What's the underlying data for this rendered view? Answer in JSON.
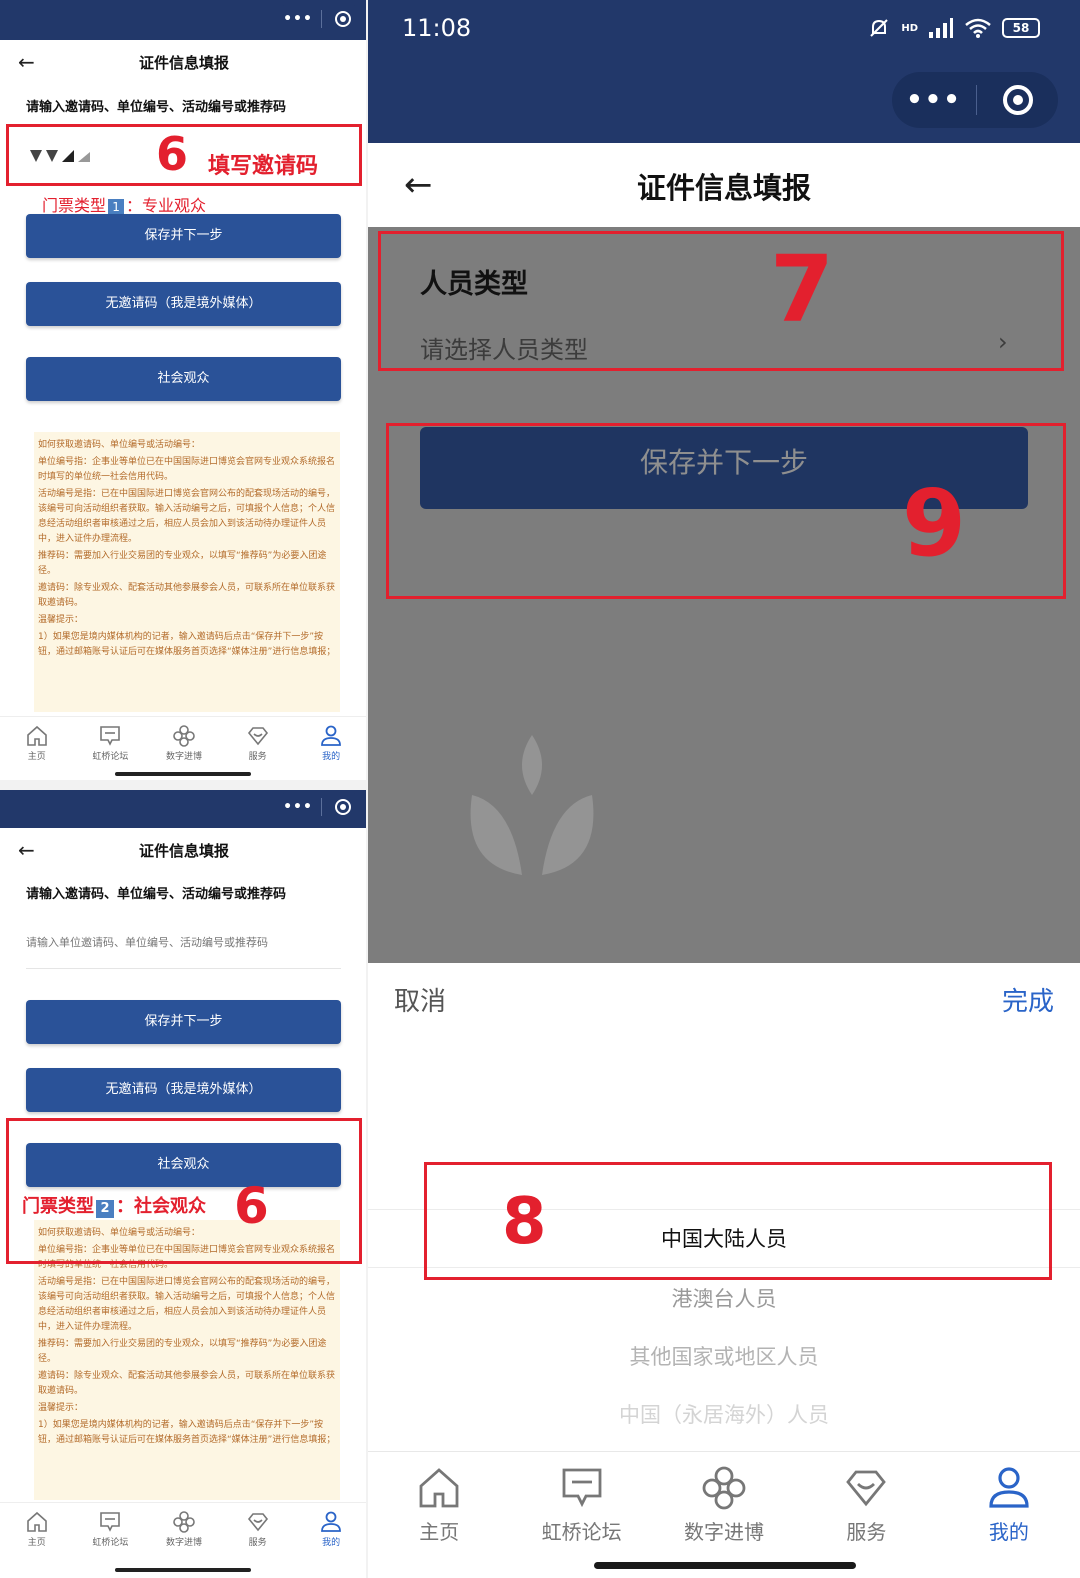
{
  "colors": {
    "brand_blue": "#22386a",
    "button_blue": "#2a5298",
    "annotation_red": "#e3202e",
    "tip_text": "#b36b2a",
    "tip_bg": "#fdf6e3",
    "done_blue": "#2a64c8"
  },
  "icons": [
    "more-dots-icon",
    "target-icon",
    "back-arrow-icon",
    "home-icon",
    "forum-icon",
    "digital-icon",
    "service-icon",
    "user-icon",
    "chevron-right-icon",
    "mute-bell-icon",
    "signal-icon",
    "wifi-icon",
    "battery-icon"
  ],
  "screen1": {
    "title": "证件信息填报",
    "prompt": "请输入邀请码、单位编号、活动编号或推荐码",
    "annotation_number": "6",
    "annotation_text": "填写邀请码",
    "ticket_note": "门票类型",
    "ticket_badge": "1",
    "ticket_value": "：专业观众",
    "buttons": {
      "save": "保存并下一步",
      "no_invite": "无邀请码（我是境外媒体）",
      "public": "社会观众"
    }
  },
  "screen2": {
    "title": "证件信息填报",
    "prompt": "请输入邀请码、单位编号、活动编号或推荐码",
    "placeholder": "请输入单位邀请码、单位编号、活动编号或推荐码",
    "annotation_number": "6",
    "ticket_note": "门票类型",
    "ticket_badge": "2",
    "ticket_value": "：社会观众",
    "buttons": {
      "save": "保存并下一步",
      "no_invite": "无邀请码（我是境外媒体）",
      "public": "社会观众"
    }
  },
  "tips": {
    "heading": "如何获取邀请码、单位编号或活动编号：",
    "p1": "单位编号指：企事业等单位已在中国国际进口博览会官网专业观众系统报名时填写的单位统一社会信用代码。",
    "p2": "活动编号是指：已在中国国际进口博览会官网公布的配套现场活动的编号，该编号可向活动组织者获取。输入活动编号之后，可填报个人信息；个人信息经活动组织者审核通过之后，相应人员会加入到该活动待办理证件人员中，进入证件办理流程。",
    "p3": "推荐码：需要加入行业交易团的专业观众，以填写“推荐码”为必要入团途径。",
    "p4": "邀请码：除专业观众、配套活动其他参展参会人员，可联系所在单位联系获取邀请码。",
    "p5": "温馨提示：",
    "p6": "1）如果您是境内媒体机构的记者，输入邀请码后点击“保存并下一步”按钮，通过邮箱账号认证后可在媒体服务首页选择“媒体注册”进行信息填报；"
  },
  "tabbar": {
    "home": "主页",
    "forum": "虹桥论坛",
    "digital": "数字进博",
    "service": "服务",
    "mine": "我的"
  },
  "right": {
    "time": "11:08",
    "battery": "58",
    "hd": "HD",
    "title": "证件信息填报",
    "field_label": "人员类型",
    "field_placeholder": "请选择人员类型",
    "save": "保存并下一步",
    "annotation_7": "7",
    "annotation_8": "8",
    "annotation_9": "9",
    "picker": {
      "cancel": "取消",
      "done": "完成",
      "options": [
        "中国大陆人员",
        "港澳台人员",
        "其他国家或地区人员",
        "中国（永居海外）人员"
      ]
    }
  }
}
